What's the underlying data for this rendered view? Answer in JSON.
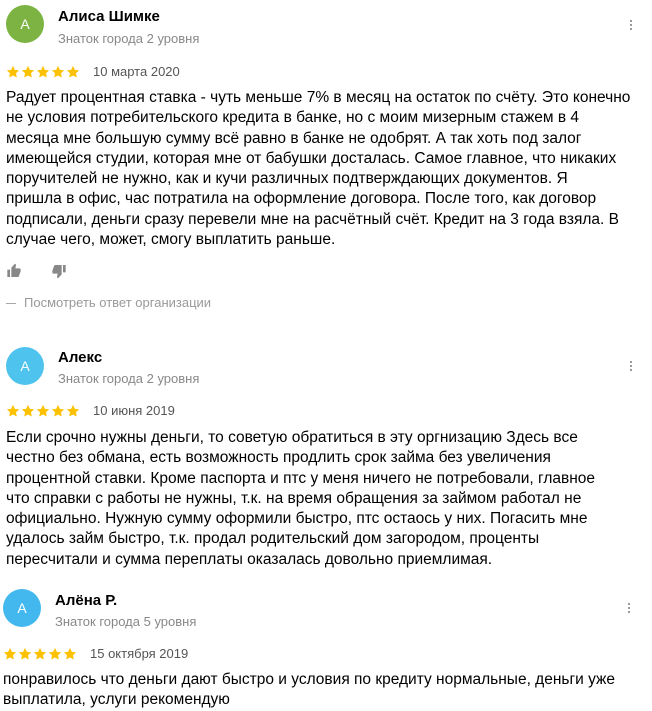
{
  "colors": {
    "avatar_green": "#7cb342",
    "avatar_blue": "#4dc3ee",
    "avatar_blue2": "#42b8ee",
    "star": "#fcc100",
    "muted": "#888888"
  },
  "reviews": [
    {
      "avatar_letter": "А",
      "author": "Алиса Шимке",
      "level": "Знаток города 2 уровня",
      "date": "10 марта 2020",
      "rating": 5,
      "text": "Радует процентная ставка - чуть меньше 7% в месяц на остаток по счёту. Это конечно\nне условия потребительского кредита в банке, но с моим мизерным стажем в 4\nмесяца мне большую сумму всё равно в банке не одобрят. А так хоть под залог\nимеющейся студии, которая мне от бабушки досталась. Самое главное, что никаких\nпоручителей не нужно, как и кучи различных подтверждающих документов. Я\nпришла в офис, час потратила на оформление договора. После того, как договор\nподписали, деньги сразу перевели мне на расчётный счёт. Кредит на 3 года взяла. В\nслучае чего, может, смогу выплатить раньше.",
      "reply_link": "Посмотреть ответ организации"
    },
    {
      "avatar_letter": "А",
      "author": "Алекс",
      "level": "Знаток города 2 уровня",
      "date": "10 июня 2019",
      "rating": 5,
      "text": "Если срочно нужны деньги, то советую обратиться в эту оргнизацию Здесь все\nчестно без обмана, есть возможность продлить срок займа без увеличения\nпроцентной ставки. Кроме паспорта и птс у меня ничего не потребовали, главное\nчто справки с работы не нужны, т.к. на время обращения за займом работал не\nофициально. Нужную сумму оформили быстро, птс остаось у них. Погасить мне\nудалось займ быстро, т.к. продал родительский дом загородом, проценты\nпересчитали и сумма переплаты оказалась довольно приемлимая."
    },
    {
      "avatar_letter": "А",
      "author": "Алёна Р.",
      "level": "Знаток города 5 уровня",
      "date": "15 октября 2019",
      "rating": 5,
      "text": "понравилось что деньги дают быстро и условия по кредиту нормальные, деньги уже\nвыплатила, услуги рекомендую"
    }
  ]
}
